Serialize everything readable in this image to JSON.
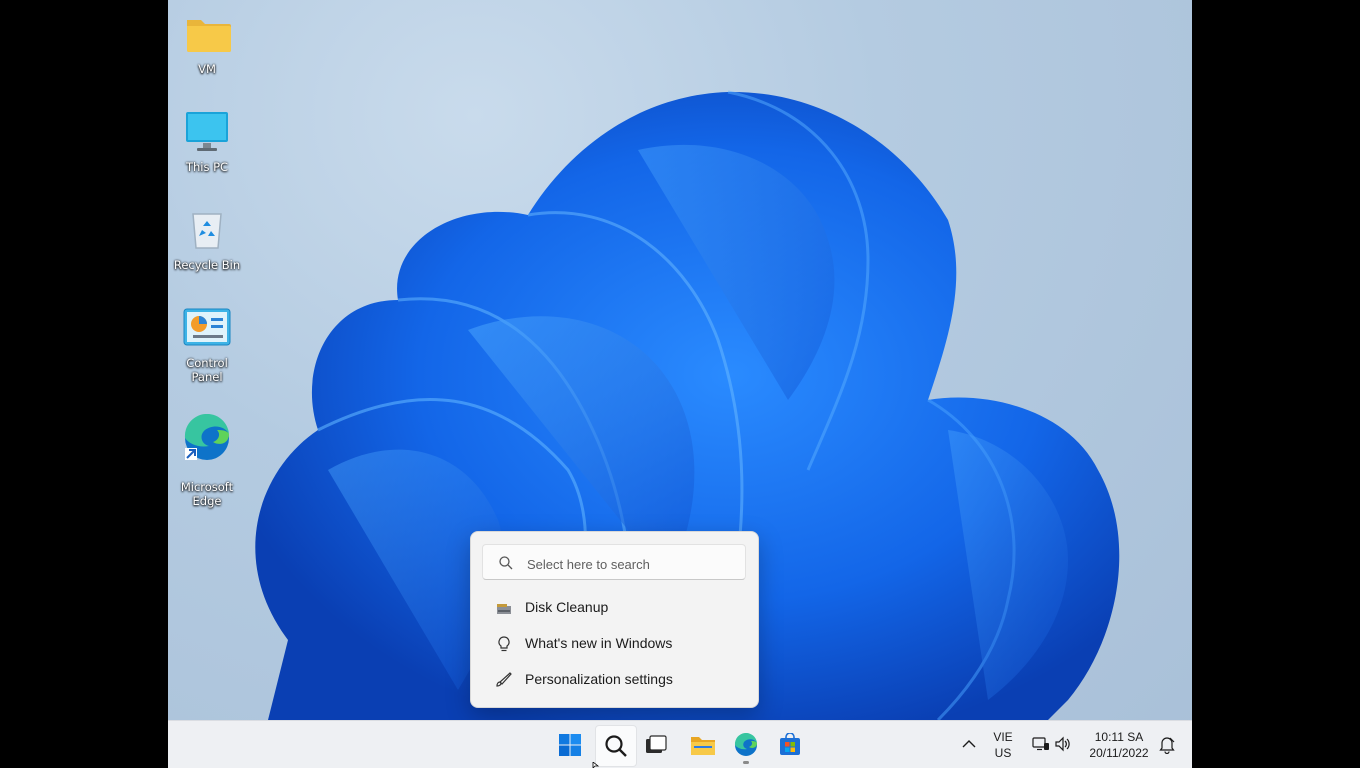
{
  "desktop": {
    "icons": [
      {
        "label": "VM",
        "icon": "folder-icon"
      },
      {
        "label": "This PC",
        "icon": "monitor-icon"
      },
      {
        "label": "Recycle Bin",
        "icon": "recycle-bin-icon"
      },
      {
        "label": "Control Panel",
        "icon": "control-panel-icon"
      },
      {
        "label": "Microsoft\nEdge",
        "icon": "edge-icon"
      }
    ]
  },
  "search_flyout": {
    "placeholder": "Select here to search",
    "items": [
      {
        "label": "Disk Cleanup",
        "icon": "disk-cleanup-icon"
      },
      {
        "label": "What's new in Windows",
        "icon": "lightbulb-icon"
      },
      {
        "label": "Personalization settings",
        "icon": "brush-icon"
      }
    ]
  },
  "taskbar": {
    "apps": [
      "start-icon",
      "search-icon",
      "task-view-icon",
      "file-explorer-icon",
      "edge-icon",
      "store-icon"
    ],
    "tray": {
      "language": "VIE",
      "keyboard": "US",
      "time": "10:11 SA",
      "date": "20/11/2022"
    }
  },
  "colors": {
    "accent": "#0a67d8",
    "folder": "#f7c948"
  }
}
